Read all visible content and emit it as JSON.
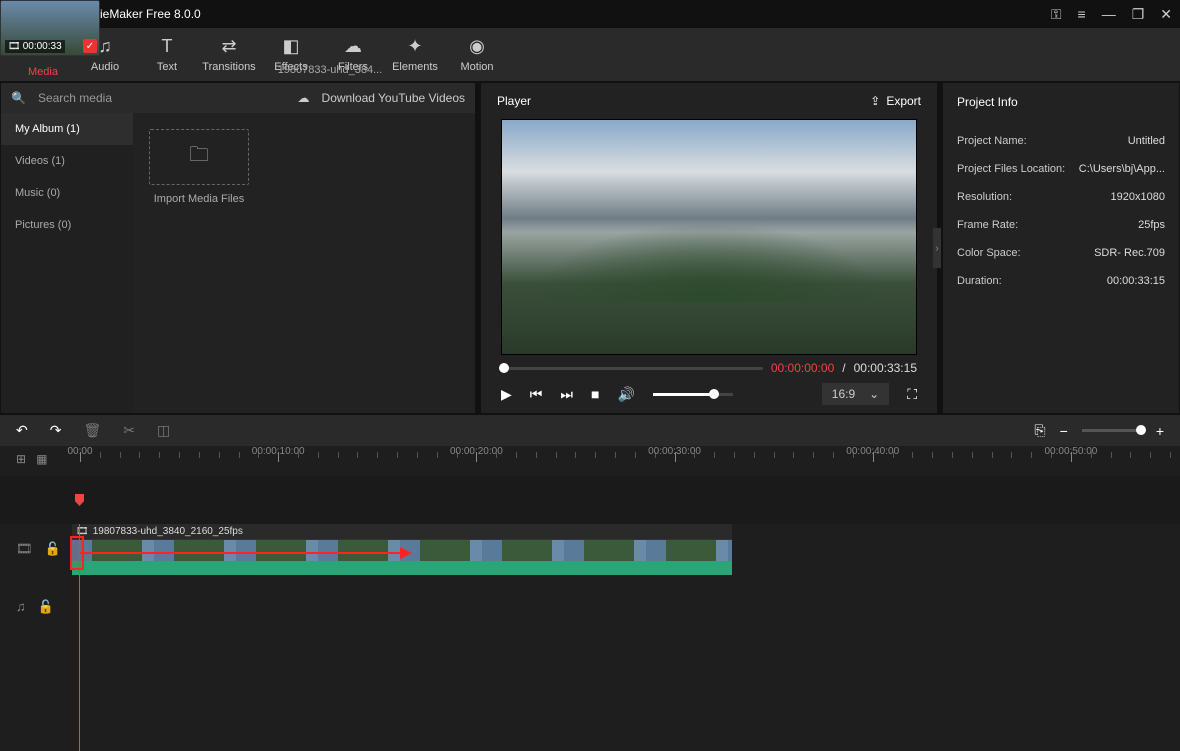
{
  "titlebar": {
    "title": "MiniTool MovieMaker Free 8.0.0"
  },
  "toolbar": {
    "items": [
      {
        "label": "Media",
        "icon": "folder-icon",
        "glyph": "🗀"
      },
      {
        "label": "Audio",
        "icon": "music-icon",
        "glyph": "♫"
      },
      {
        "label": "Text",
        "icon": "text-icon",
        "glyph": "T"
      },
      {
        "label": "Transitions",
        "icon": "transitions-icon",
        "glyph": "⇄"
      },
      {
        "label": "Effects",
        "icon": "effects-icon",
        "glyph": "◧"
      },
      {
        "label": "Filters",
        "icon": "filters-icon",
        "glyph": "☁"
      },
      {
        "label": "Elements",
        "icon": "elements-icon",
        "glyph": "✦"
      },
      {
        "label": "Motion",
        "icon": "motion-icon",
        "glyph": "◉"
      }
    ]
  },
  "media": {
    "search_placeholder": "Search media",
    "download_label": "Download YouTube Videos",
    "albums": [
      {
        "label": "My Album (1)"
      },
      {
        "label": "Videos (1)"
      },
      {
        "label": "Music (0)"
      },
      {
        "label": "Pictures (0)"
      }
    ],
    "import_label": "Import Media Files",
    "clip": {
      "name": "19807833-uhd_384...",
      "duration": "00:00:33"
    }
  },
  "player": {
    "title": "Player",
    "export": "Export",
    "current": "00:00:00:00",
    "total": "00:00:33:15",
    "ratio": "16:9"
  },
  "info": {
    "title": "Project Info",
    "rows": [
      {
        "k": "Project Name:",
        "v": "Untitled"
      },
      {
        "k": "Project Files Location:",
        "v": "C:\\Users\\bj\\App..."
      },
      {
        "k": "Resolution:",
        "v": "1920x1080"
      },
      {
        "k": "Frame Rate:",
        "v": "25fps"
      },
      {
        "k": "Color Space:",
        "v": "SDR- Rec.709"
      },
      {
        "k": "Duration:",
        "v": "00:00:33:15"
      }
    ]
  },
  "ruler": {
    "labels": [
      "00:00",
      "00:00:10:00",
      "00:00:20:00",
      "00:00:30:00",
      "00:00:40:00",
      "00:00:50:00"
    ]
  },
  "timeline": {
    "clip_name": "19807833-uhd_3840_2160_25fps"
  }
}
